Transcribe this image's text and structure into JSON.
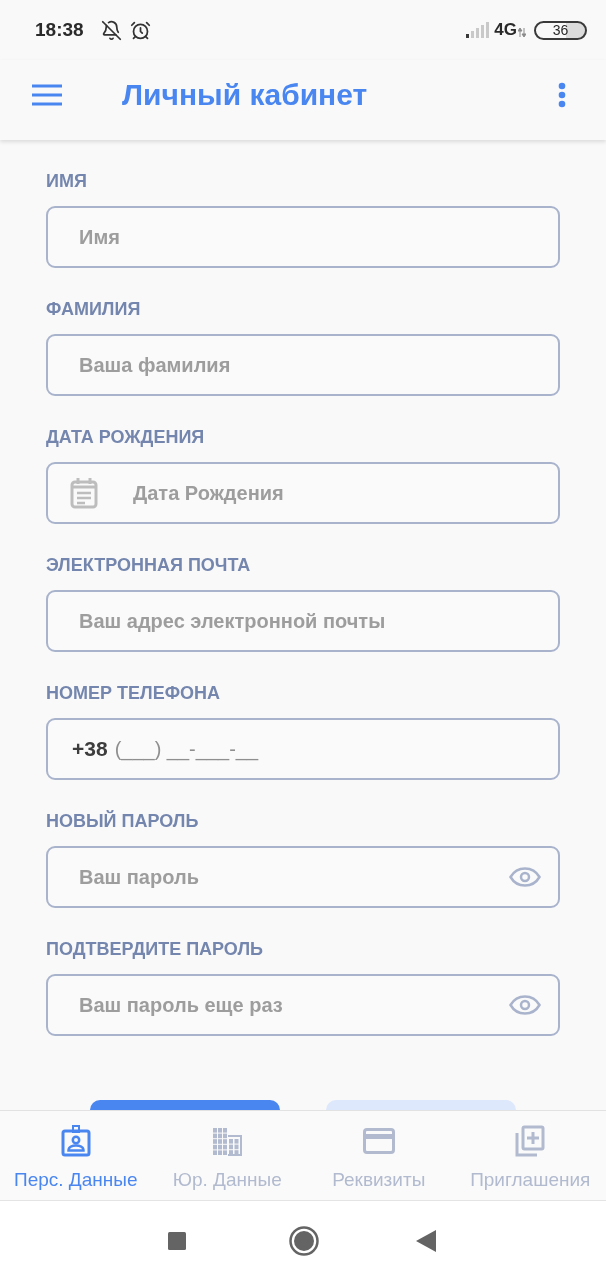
{
  "status_bar": {
    "time": "18:38",
    "network": "4G",
    "battery": "36"
  },
  "app_bar": {
    "title": "Личный кабинет"
  },
  "form": {
    "fields": [
      {
        "kind": "text",
        "label": "ИМЯ",
        "placeholder": "Имя"
      },
      {
        "kind": "text",
        "label": "ФАМИЛИЯ",
        "placeholder": "Ваша фамилия"
      },
      {
        "kind": "date",
        "label": "ДАТА РОЖДЕНИЯ",
        "placeholder": "Дата Рождения"
      },
      {
        "kind": "text",
        "label": "ЭЛЕКТРОННАЯ ПОЧТА",
        "placeholder": "Ваш адрес электронной почты"
      },
      {
        "kind": "phone",
        "label": "НОМЕР ТЕЛЕФОНА",
        "prefix": "+38",
        "placeholder": "(___) __-___-__"
      },
      {
        "kind": "password",
        "label": "НОВЫЙ ПАРОЛЬ",
        "placeholder": "Ваш пароль"
      },
      {
        "kind": "password",
        "label": "ПОДТВЕРДИТЕ ПАРОЛЬ",
        "placeholder": "Ваш пароль еще раз"
      }
    ],
    "buttons": [
      {
        "kind": "primary"
      },
      {
        "kind": "secondary"
      }
    ]
  },
  "bottom_nav": {
    "tabs": [
      {
        "label": "Перс. Данные",
        "selected": true
      },
      {
        "label": "Юр. Данные",
        "selected": false
      },
      {
        "label": "Реквизиты",
        "selected": false
      },
      {
        "label": "Приглашения",
        "selected": false
      }
    ]
  }
}
